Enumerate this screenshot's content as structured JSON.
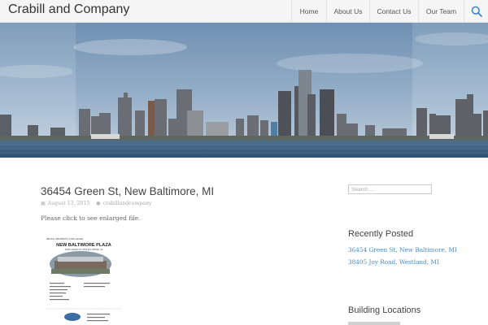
{
  "site": {
    "title": "Crabill and Company"
  },
  "nav": {
    "items": [
      "Home",
      "About Us",
      "Contact Us",
      "Our Team"
    ],
    "search_icon": "search-icon"
  },
  "post": {
    "title": "36454 Green St, New Baltimore, MI",
    "date": "August 13, 2015",
    "author": "crabillandcompany",
    "body": "Please click to see enlarged file.",
    "thumbnail": {
      "header": "RETAIL PROPERTY FOR LEASE",
      "title": "NEW BALTIMORE PLAZA",
      "address": "36454 GREEN ST. NEW BALTIMORE, MI"
    }
  },
  "sidebar": {
    "search_placeholder": "Search ...",
    "recent_title": "Recently Posted",
    "recent_posts": [
      "36454 Green St, New Baltimore, MI",
      "38405 Joy Road, Westland, MI"
    ],
    "locations_title": "Building Locations"
  },
  "colors": {
    "link": "#4a8bc2",
    "sky": "#8aa7c3",
    "water": "#3f6480",
    "search_icon": "#3b7fc4"
  }
}
